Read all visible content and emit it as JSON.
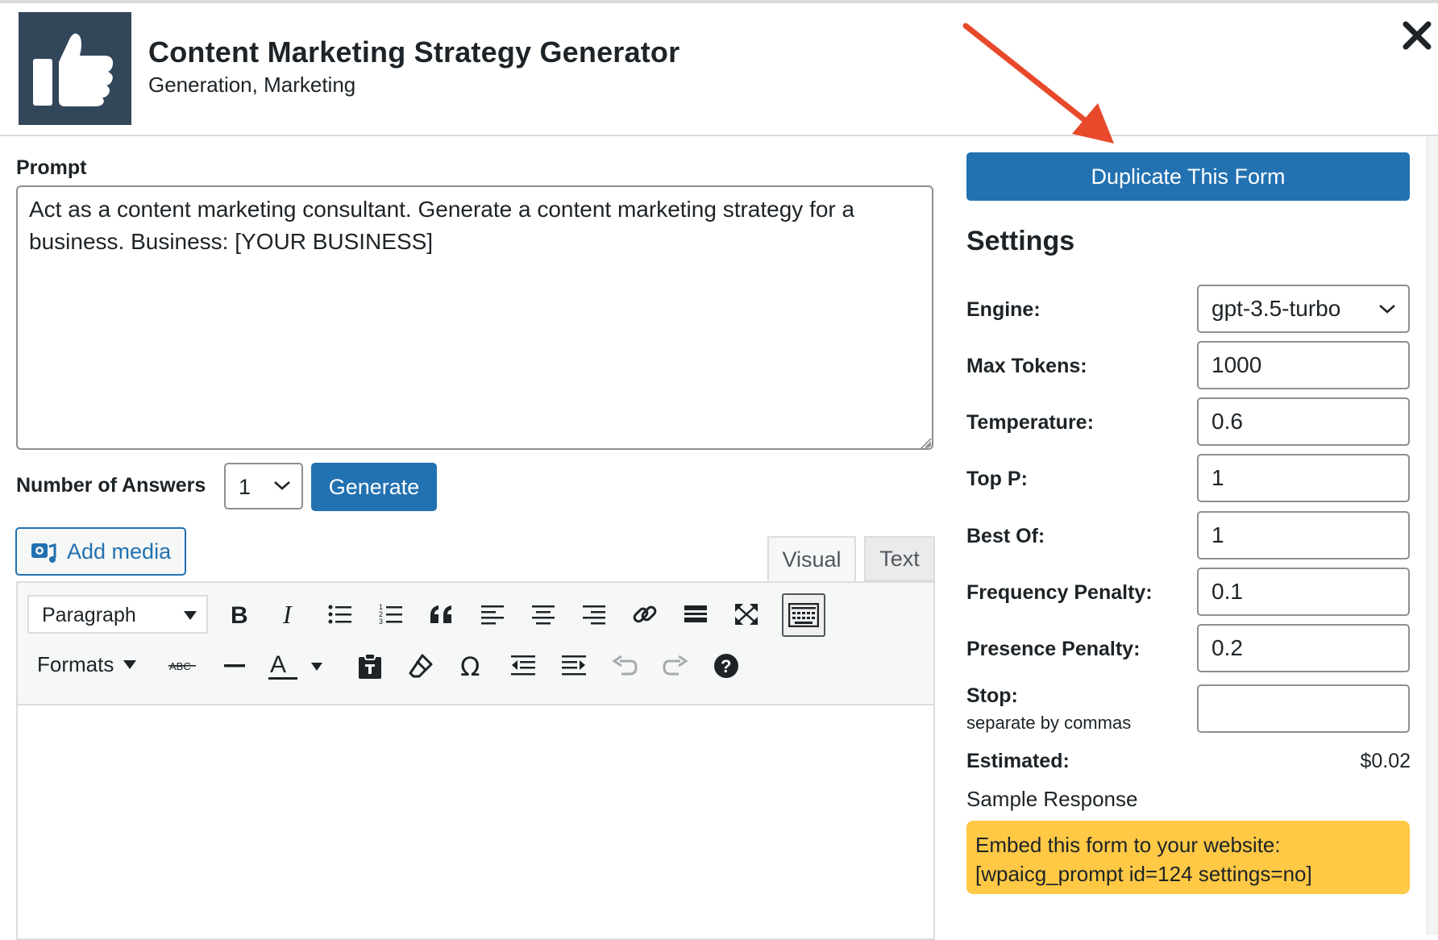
{
  "header": {
    "title": "Content Marketing Strategy Generator",
    "subtitle": "Generation, Marketing",
    "logo_icon": "thumbs-up-icon",
    "close_icon": "close-icon"
  },
  "prompt": {
    "label": "Prompt",
    "value": "Act as a content marketing consultant. Generate a content marketing strategy for a business. Business: [YOUR BUSINESS]"
  },
  "answers": {
    "label": "Number of Answers",
    "selected": "1",
    "generate_label": "Generate"
  },
  "editor": {
    "add_media_label": "Add media",
    "tab_visual": "Visual",
    "tab_text": "Text",
    "paragraph_selected": "Paragraph",
    "formats_label": "Formats",
    "text_color_glyph": "A",
    "strike_glyph": "ABC"
  },
  "settings": {
    "duplicate_label": "Duplicate This Form",
    "heading": "Settings",
    "engine_label": "Engine:",
    "engine_value": "gpt-3.5-turbo",
    "max_tokens_label": "Max Tokens:",
    "max_tokens_value": "1000",
    "temperature_label": "Temperature:",
    "temperature_value": "0.6",
    "top_p_label": "Top P:",
    "top_p_value": "1",
    "best_of_label": "Best Of:",
    "best_of_value": "1",
    "frequency_label": "Frequency Penalty:",
    "frequency_value": "0.1",
    "presence_label": "Presence Penalty:",
    "presence_value": "0.2",
    "stop_label": "Stop:",
    "stop_sub": "separate by commas",
    "stop_value": "",
    "estimated_label": "Estimated:",
    "estimated_value": "$0.02",
    "sample_label": "Sample Response",
    "embed_line1": "Embed this form to your website:",
    "embed_line2": "[wpaicg_prompt id=124 settings=no]"
  },
  "colors": {
    "primary": "#2271b1",
    "logo_bg": "#33475b",
    "embed_bg": "#ffc845",
    "arrow": "#e8492b"
  }
}
